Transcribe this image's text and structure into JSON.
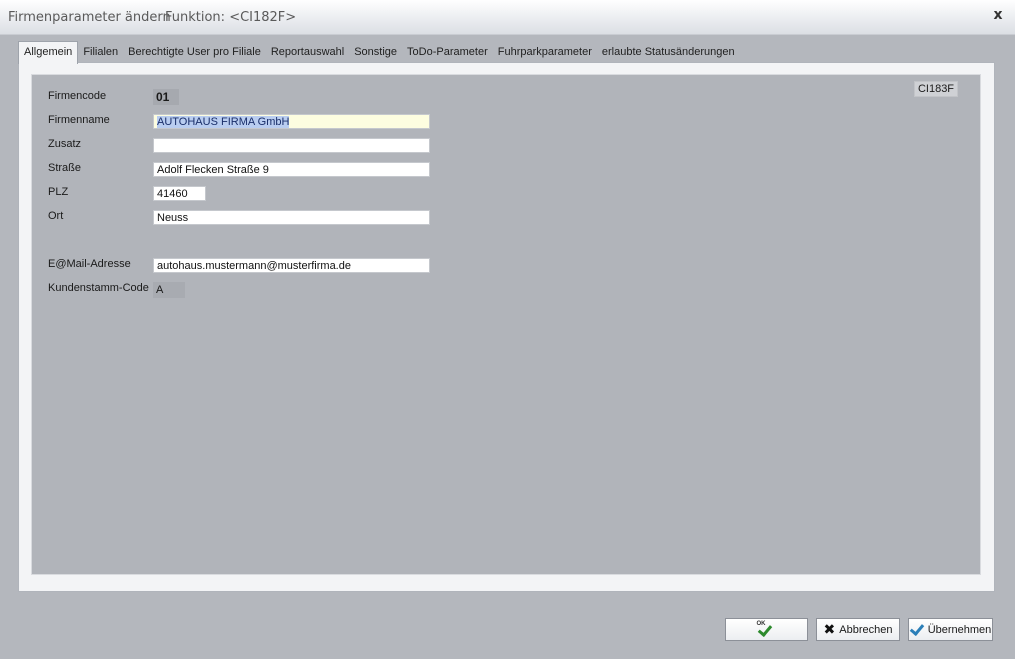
{
  "window": {
    "title": "Firmenparameter ändern",
    "function_label": "Funktion: <CI182F>",
    "close_glyph": "x"
  },
  "tabs": [
    {
      "label": "Allgemein",
      "active": true
    },
    {
      "label": "Filialen"
    },
    {
      "label": "Berechtigte User pro Filiale"
    },
    {
      "label": "Reportauswahl"
    },
    {
      "label": "Sonstige"
    },
    {
      "label": "ToDo-Parameter"
    },
    {
      "label": "Fuhrparkparameter"
    },
    {
      "label": "erlaubte Statusänderungen"
    }
  ],
  "form": {
    "form_id": "CI183F",
    "firmencode": {
      "label": "Firmencode",
      "value": "01"
    },
    "firmenname": {
      "label": "Firmenname",
      "value": "AUTOHAUS FIRMA GmbH"
    },
    "zusatz": {
      "label": "Zusatz",
      "value": ""
    },
    "strasse": {
      "label": "Straße",
      "value": "Adolf Flecken Straße 9"
    },
    "plz": {
      "label": "PLZ",
      "value": "41460"
    },
    "ort": {
      "label": "Ort",
      "value": "Neuss"
    },
    "email": {
      "label": "E@Mail-Adresse",
      "value": "autohaus.mustermann@musterfirma.de"
    },
    "kundenstamm": {
      "label": "Kundenstamm-Code",
      "value": "A"
    }
  },
  "buttons": {
    "ok_label": "",
    "ok_icon": "ok-check-icon",
    "cancel_label": "Abbrechen",
    "cancel_icon": "x-icon",
    "apply_label": "Übernehmen",
    "apply_icon": "check-icon"
  }
}
